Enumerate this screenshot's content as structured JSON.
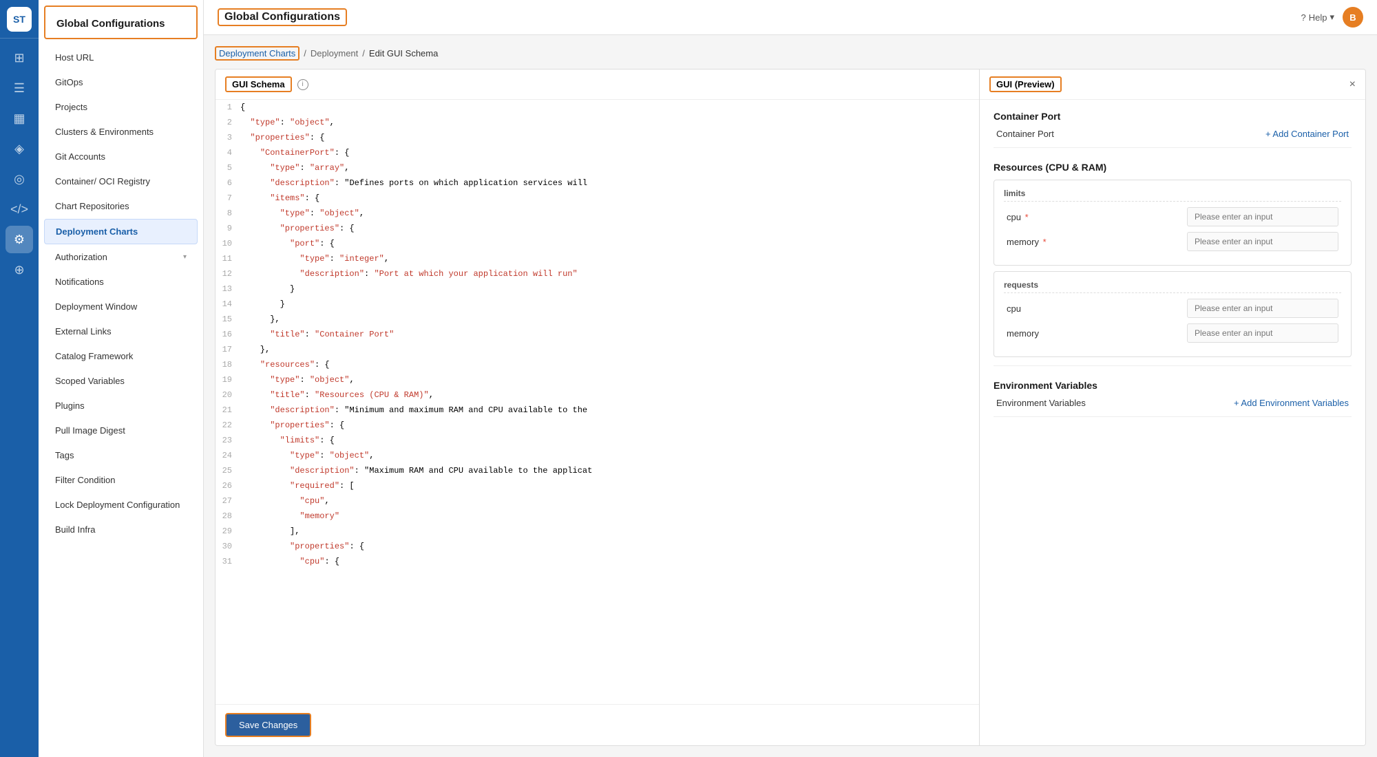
{
  "app": {
    "logo": "ST",
    "title": "Global Configurations"
  },
  "header": {
    "title": "Global Configurations",
    "help_label": "Help",
    "user_initial": "B"
  },
  "breadcrumb": {
    "link1": "Deployment Charts",
    "sep1": "/",
    "link2": "Deployment",
    "sep2": "/",
    "current": "Edit GUI Schema"
  },
  "sidebar": {
    "items": [
      {
        "label": "Host URL",
        "active": false
      },
      {
        "label": "GitOps",
        "active": false
      },
      {
        "label": "Projects",
        "active": false
      },
      {
        "label": "Clusters & Environments",
        "active": false
      },
      {
        "label": "Git Accounts",
        "active": false
      },
      {
        "label": "Container/ OCI Registry",
        "active": false
      },
      {
        "label": "Chart Repositories",
        "active": false
      },
      {
        "label": "Deployment Charts",
        "active": true
      },
      {
        "label": "Authorization",
        "active": false,
        "has_chevron": true
      },
      {
        "label": "Notifications",
        "active": false
      },
      {
        "label": "Deployment Window",
        "active": false
      },
      {
        "label": "External Links",
        "active": false
      },
      {
        "label": "Catalog Framework",
        "active": false
      },
      {
        "label": "Scoped Variables",
        "active": false
      },
      {
        "label": "Plugins",
        "active": false
      },
      {
        "label": "Pull Image Digest",
        "active": false
      },
      {
        "label": "Tags",
        "active": false
      },
      {
        "label": "Filter Condition",
        "active": false
      },
      {
        "label": "Lock Deployment Configuration",
        "active": false
      },
      {
        "label": "Build Infra",
        "active": false
      }
    ]
  },
  "schema_panel": {
    "title": "GUI Schema",
    "info_icon": "ℹ",
    "code_lines": [
      {
        "num": 1,
        "content": "{"
      },
      {
        "num": 2,
        "content": "  \"type\": \"object\","
      },
      {
        "num": 3,
        "content": "  \"properties\": {"
      },
      {
        "num": 4,
        "content": "    \"ContainerPort\": {"
      },
      {
        "num": 5,
        "content": "      \"type\": \"array\","
      },
      {
        "num": 6,
        "content": "      \"description\": \"Defines ports on which application services will"
      },
      {
        "num": 7,
        "content": "      \"items\": {"
      },
      {
        "num": 8,
        "content": "        \"type\": \"object\","
      },
      {
        "num": 9,
        "content": "        \"properties\": {"
      },
      {
        "num": 10,
        "content": "          \"port\": {"
      },
      {
        "num": 11,
        "content": "            \"type\": \"integer\","
      },
      {
        "num": 12,
        "content": "            \"description\": \"Port at which your application will run\""
      },
      {
        "num": 13,
        "content": "          }"
      },
      {
        "num": 14,
        "content": "        }"
      },
      {
        "num": 15,
        "content": "      },"
      },
      {
        "num": 16,
        "content": "      \"title\": \"Container Port\""
      },
      {
        "num": 17,
        "content": "    },"
      },
      {
        "num": 18,
        "content": "    \"resources\": {"
      },
      {
        "num": 19,
        "content": "      \"type\": \"object\","
      },
      {
        "num": 20,
        "content": "      \"title\": \"Resources (CPU & RAM)\","
      },
      {
        "num": 21,
        "content": "      \"description\": \"Minimum and maximum RAM and CPU available to the"
      },
      {
        "num": 22,
        "content": "      \"properties\": {"
      },
      {
        "num": 23,
        "content": "        \"limits\": {"
      },
      {
        "num": 24,
        "content": "          \"type\": \"object\","
      },
      {
        "num": 25,
        "content": "          \"description\": \"Maximum RAM and CPU available to the applicat"
      },
      {
        "num": 26,
        "content": "          \"required\": ["
      },
      {
        "num": 27,
        "content": "            \"cpu\","
      },
      {
        "num": 28,
        "content": "            \"memory\""
      },
      {
        "num": 29,
        "content": "          ],"
      },
      {
        "num": 30,
        "content": "          \"properties\": {"
      },
      {
        "num": 31,
        "content": "            \"cpu\": {"
      }
    ],
    "save_button": "Save Changes"
  },
  "preview_panel": {
    "title": "GUI (Preview)",
    "close_icon": "×",
    "sections": [
      {
        "title": "Container Port",
        "fields": [
          {
            "label": "Container Port",
            "type": "link",
            "link_text": "+ Add Container Port"
          }
        ]
      },
      {
        "title": "Resources (CPU & RAM)",
        "subsections": [
          {
            "title": "limits",
            "fields": [
              {
                "label": "cpu",
                "required": true,
                "placeholder": "Please enter an input"
              },
              {
                "label": "memory",
                "required": true,
                "placeholder": "Please enter an input"
              }
            ]
          },
          {
            "title": "requests",
            "fields": [
              {
                "label": "cpu",
                "required": false,
                "placeholder": "Please enter an input"
              },
              {
                "label": "memory",
                "required": false,
                "placeholder": "Please enter an input"
              }
            ]
          }
        ]
      },
      {
        "title": "Environment Variables",
        "fields": [
          {
            "label": "Environment Variables",
            "type": "link",
            "link_text": "+ Add Environment Variables"
          }
        ]
      }
    ]
  },
  "icons": {
    "dashboard": "⊞",
    "layers": "≡",
    "grid": "⊟",
    "package": "◈",
    "globe": "◎",
    "code": "</>",
    "settings": "⚙",
    "stack": "⊕",
    "question": "?",
    "chevron_down": "▾"
  }
}
